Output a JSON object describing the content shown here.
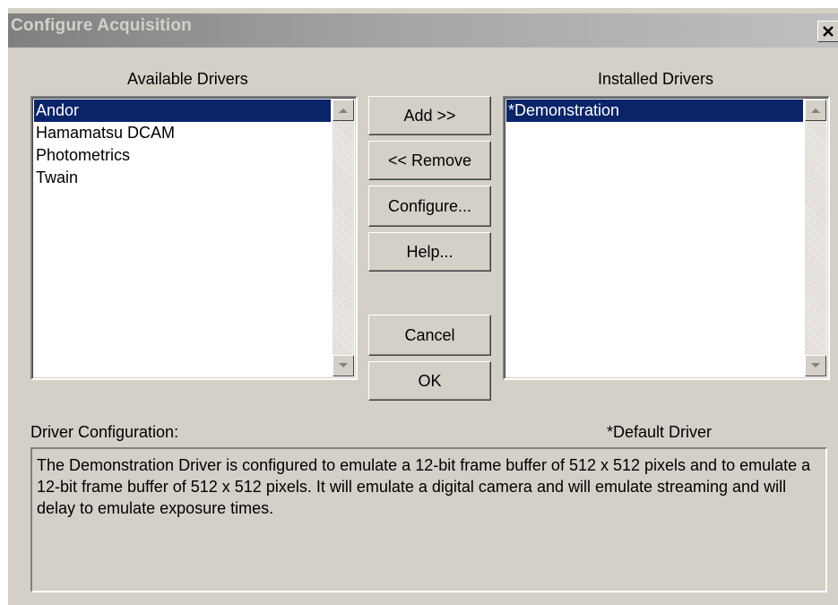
{
  "window": {
    "title": "Configure Acquisition",
    "close_icon": "close-icon"
  },
  "available": {
    "label": "Available Drivers",
    "items": [
      "Andor",
      "Hamamatsu DCAM",
      "Photometrics",
      "Twain"
    ],
    "selected": "Andor"
  },
  "installed": {
    "label": "Installed Drivers",
    "items": [
      "*Demonstration"
    ],
    "selected": "*Demonstration"
  },
  "buttons": {
    "add": "Add >>",
    "remove": "<< Remove",
    "configure": "Configure...",
    "help": "Help...",
    "cancel": "Cancel",
    "ok": "OK"
  },
  "config": {
    "label": "Driver Configuration:",
    "default_note": "*Default Driver",
    "text": "The Demonstration Driver is configured to emulate a 12-bit frame buffer of 512 x 512 pixels and to emulate a 12-bit frame buffer of 512 x 512 pixels.  It will emulate a digital camera and will emulate streaming and will delay to emulate exposure times."
  },
  "colors": {
    "face": "#d4d0c8",
    "selection": "#0a246a",
    "title_start": "#808080",
    "title_end": "#c0c0c0"
  }
}
